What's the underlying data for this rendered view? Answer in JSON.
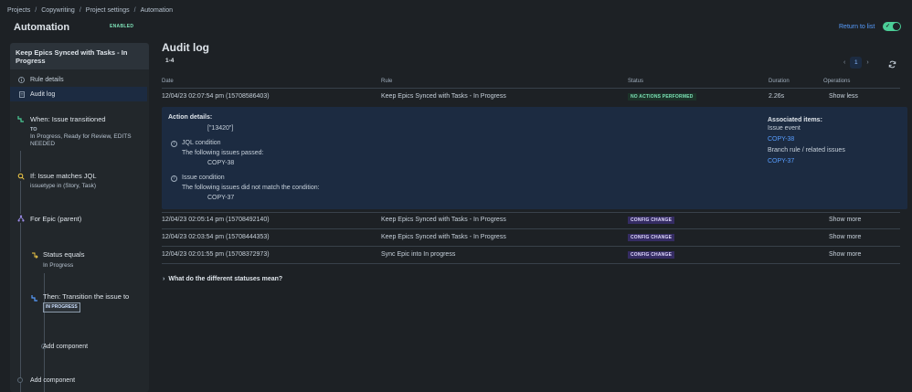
{
  "breadcrumb": [
    "Projects",
    "Copywriting",
    "Project settings",
    "Automation"
  ],
  "page": {
    "title": "Automation",
    "status_badge": "ENABLED",
    "return_link": "Return to list",
    "toggle_on": true
  },
  "sidebar": {
    "rule_name": "Keep Epics Synced with Tasks - In Progress",
    "nav": [
      {
        "label": "Rule details",
        "icon": "info-icon"
      },
      {
        "label": "Audit log",
        "icon": "document-icon",
        "active": true
      }
    ],
    "steps": {
      "trigger": {
        "title": "When: Issue transitioned",
        "to_label": "TO",
        "detail": "In Progress, Ready for Review, EDITS NEEDED"
      },
      "condition": {
        "title": "If: Issue matches JQL",
        "detail": "issuetype in (Story, Task)"
      },
      "branch": {
        "title": "For Epic (parent)"
      },
      "status_condition": {
        "title": "Status equals",
        "detail": "In Progress"
      },
      "action": {
        "title": "Then: Transition the issue to",
        "lozenge": "IN PROGRESS"
      },
      "add_component_inner": "Add component",
      "add_component_outer": "Add component"
    }
  },
  "audit": {
    "title": "Audit log",
    "range": "1-4",
    "pagination": {
      "current": "1",
      "prev": "‹",
      "next": "›"
    },
    "columns": {
      "date": "Date",
      "rule": "Rule",
      "status": "Status",
      "duration": "Duration",
      "operations": "Operations"
    },
    "rows": [
      {
        "date": "12/04/23 02:07:54 pm (15708586403)",
        "rule": "Keep Epics Synced with Tasks - In Progress",
        "status": "NO ACTIONS PERFORMED",
        "duration": "2.26s",
        "op": "Show less"
      },
      {
        "date": "12/04/23 02:05:14 pm (15708492140)",
        "rule": "Keep Epics Synced with Tasks - In Progress",
        "status": "CONFIG CHANGE",
        "duration": "",
        "op": "Show more"
      },
      {
        "date": "12/04/23 02:03:54 pm (15708444353)",
        "rule": "Keep Epics Synced with Tasks - In Progress",
        "status": "CONFIG CHANGE",
        "duration": "",
        "op": "Show more"
      },
      {
        "date": "12/04/23 02:01:55 pm (15708372973)",
        "rule": "Sync Epic into In progress",
        "status": "CONFIG CHANGE",
        "duration": "",
        "op": "Show more"
      }
    ],
    "details": {
      "heading": "Action details:",
      "id_list": "[\"13420\"]",
      "jql_title": "JQL condition",
      "jql_text": "The following issues passed:",
      "jql_issue": "COPY-38",
      "issue_cond_title": "Issue condition",
      "issue_cond_text": "The following issues did not match the condition:",
      "issue_cond_issue": "COPY-37",
      "associated_heading": "Associated items:",
      "issue_event": "Issue event",
      "issue_event_link": "COPY-38",
      "branch_label": "Branch rule / related issues",
      "branch_link": "COPY-37"
    },
    "faq": "What do the different statuses mean?"
  },
  "colors": {
    "background": "#1d2125",
    "link": "#579dff",
    "success": "#7ee2b8",
    "config": "#352c63"
  }
}
